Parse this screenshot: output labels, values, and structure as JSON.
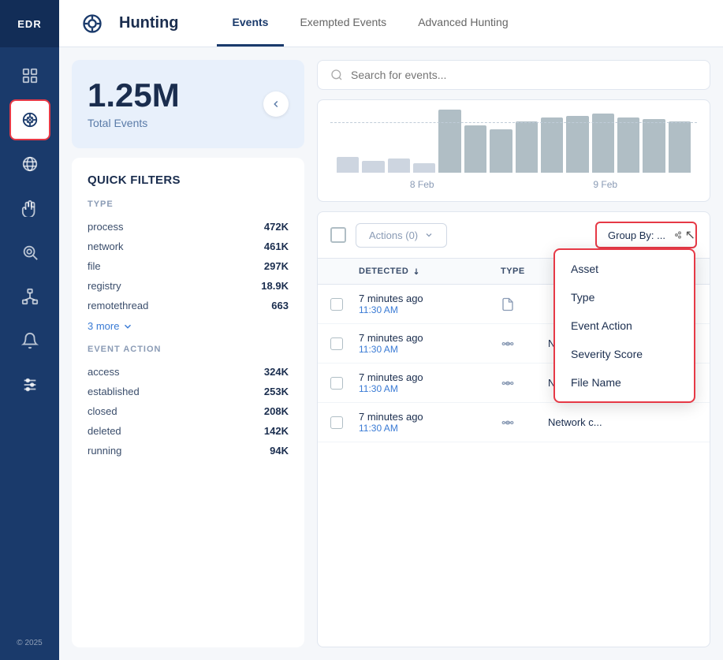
{
  "app": {
    "brand": "EDR",
    "title": "Hunting",
    "copyright": "© 2025"
  },
  "header": {
    "tabs": [
      {
        "id": "events",
        "label": "Events",
        "active": true
      },
      {
        "id": "exempted",
        "label": "Exempted Events",
        "active": false
      },
      {
        "id": "advanced",
        "label": "Advanced Hunting",
        "active": false
      }
    ]
  },
  "total_events": {
    "number": "1.25M",
    "label": "Total Events"
  },
  "quick_filters": {
    "title": "QUICK FILTERS",
    "type_section": "TYPE",
    "types": [
      {
        "name": "process",
        "count": "472K"
      },
      {
        "name": "network",
        "count": "461K"
      },
      {
        "name": "file",
        "count": "297K"
      },
      {
        "name": "registry",
        "count": "18.9K"
      },
      {
        "name": "remotethread",
        "count": "663"
      }
    ],
    "more_label": "3 more",
    "event_action_section": "EVENT ACTION",
    "event_actions": [
      {
        "name": "access",
        "count": "324K"
      },
      {
        "name": "established",
        "count": "253K"
      },
      {
        "name": "closed",
        "count": "208K"
      },
      {
        "name": "deleted",
        "count": "142K"
      },
      {
        "name": "running",
        "count": "94K"
      }
    ]
  },
  "search": {
    "placeholder": "Search for events..."
  },
  "chart": {
    "labels": [
      "8 Feb",
      "9 Feb"
    ],
    "bars": [
      20,
      15,
      18,
      12,
      80,
      60,
      55,
      65,
      70,
      72,
      75,
      70,
      68,
      65
    ]
  },
  "toolbar": {
    "actions_label": "Actions (0)",
    "group_by_label": "Group By: ..."
  },
  "table": {
    "columns": [
      "DETECTED",
      "TYPE",
      ""
    ],
    "rows": [
      {
        "time_ago": "7 minutes ago",
        "time": "11:30 AM",
        "icon": "file",
        "text": ""
      },
      {
        "time_ago": "7 minutes ago",
        "time": "11:30 AM",
        "icon": "network",
        "text": "Network c..."
      },
      {
        "time_ago": "7 minutes ago",
        "time": "11:30 AM",
        "icon": "network",
        "text": "Network c..."
      },
      {
        "time_ago": "7 minutes ago",
        "time": "11:30 AM",
        "icon": "network",
        "text": "Network c..."
      }
    ]
  },
  "group_by_dropdown": {
    "items": [
      "Asset",
      "Type",
      "Event Action",
      "Severity Score",
      "File Name"
    ]
  },
  "sidebar": {
    "items": [
      {
        "id": "dashboard",
        "icon": "grid"
      },
      {
        "id": "hunting",
        "icon": "target",
        "active": true
      },
      {
        "id": "globe",
        "icon": "globe"
      },
      {
        "id": "hand",
        "icon": "hand"
      },
      {
        "id": "search2",
        "icon": "search2"
      },
      {
        "id": "network",
        "icon": "network"
      },
      {
        "id": "bell",
        "icon": "bell"
      },
      {
        "id": "sliders",
        "icon": "sliders"
      }
    ]
  }
}
